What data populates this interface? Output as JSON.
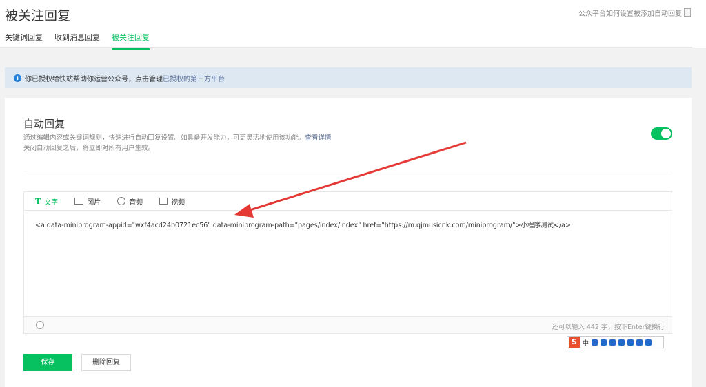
{
  "page": {
    "title": "被关注回复",
    "help_link": "公众平台如何设置被添加自动回复"
  },
  "tabs": [
    {
      "label": "关键词回复",
      "active": false
    },
    {
      "label": "收到消息回复",
      "active": false
    },
    {
      "label": "被关注回复",
      "active": true
    }
  ],
  "notice": {
    "text": "你已授权给快站帮助你运营公众号，点击管理",
    "link": "已授权的第三方平台"
  },
  "auto_reply": {
    "title": "自动回复",
    "desc_prefix": "通过编辑内容或关键词规则，快速进行自动回复设置。如具备开发能力，可更灵活地使用该功能。",
    "desc_link": "查看详情",
    "desc_line2": "关闭自动回复之后，将立即对所有用户生效。",
    "enabled": true
  },
  "editor": {
    "tabs": [
      {
        "label": "文字",
        "icon": "text-icon",
        "active": true
      },
      {
        "label": "图片",
        "icon": "image-icon",
        "active": false
      },
      {
        "label": "音频",
        "icon": "audio-icon",
        "active": false
      },
      {
        "label": "视频",
        "icon": "video-icon",
        "active": false
      }
    ],
    "content": "<a data-miniprogram-appid=\"wxf4acd24b0721ec56\" data-miniprogram-path=\"pages/index/index\" href=\"https://m.qjmusicnk.com/miniprogram/\">小程序测试</a>",
    "counter": "还可以输入 442 字，按下Enter键换行"
  },
  "ime": {
    "logo": "S",
    "mode": "中"
  },
  "buttons": {
    "save": "保存",
    "delete": "删除回复"
  },
  "colors": {
    "accent": "#07c160",
    "link": "#576b95",
    "notice_bg": "#dde8f3",
    "arrow": "#e53935"
  }
}
